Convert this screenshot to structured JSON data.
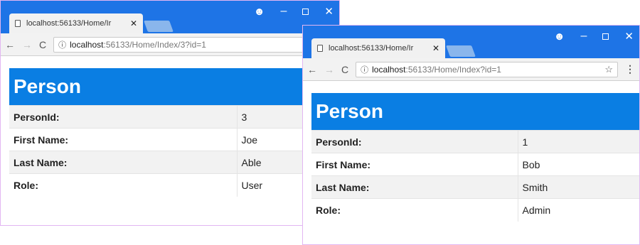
{
  "windows": [
    {
      "tab_title": "localhost:56133/Home/Ir",
      "address_host": "localhost",
      "address_path": ":56133/Home/Index/3?id=1",
      "heading": "Person",
      "rows": [
        {
          "label": "PersonId:",
          "value": "3"
        },
        {
          "label": "First Name:",
          "value": "Joe"
        },
        {
          "label": "Last Name:",
          "value": "Able"
        },
        {
          "label": "Role:",
          "value": "User"
        }
      ]
    },
    {
      "tab_title": "localhost:56133/Home/Ir",
      "address_host": "localhost",
      "address_path": ":56133/Home/Index?id=1",
      "heading": "Person",
      "rows": [
        {
          "label": "PersonId:",
          "value": "1"
        },
        {
          "label": "First Name:",
          "value": "Bob"
        },
        {
          "label": "Last Name:",
          "value": "Smith"
        },
        {
          "label": "Role:",
          "value": "Admin"
        }
      ]
    }
  ],
  "icons": {
    "back": "←",
    "forward": "→",
    "reload": "C",
    "info": "ⓘ",
    "close_tab": "✕",
    "profile": "☻",
    "minimize": "–",
    "close_window": "✕",
    "star": "☆",
    "menu": "⋮"
  },
  "colors": {
    "titlebar": "#1e74e6",
    "heading_bg": "#0a7ee3",
    "window_border": "#e2b6f2"
  }
}
